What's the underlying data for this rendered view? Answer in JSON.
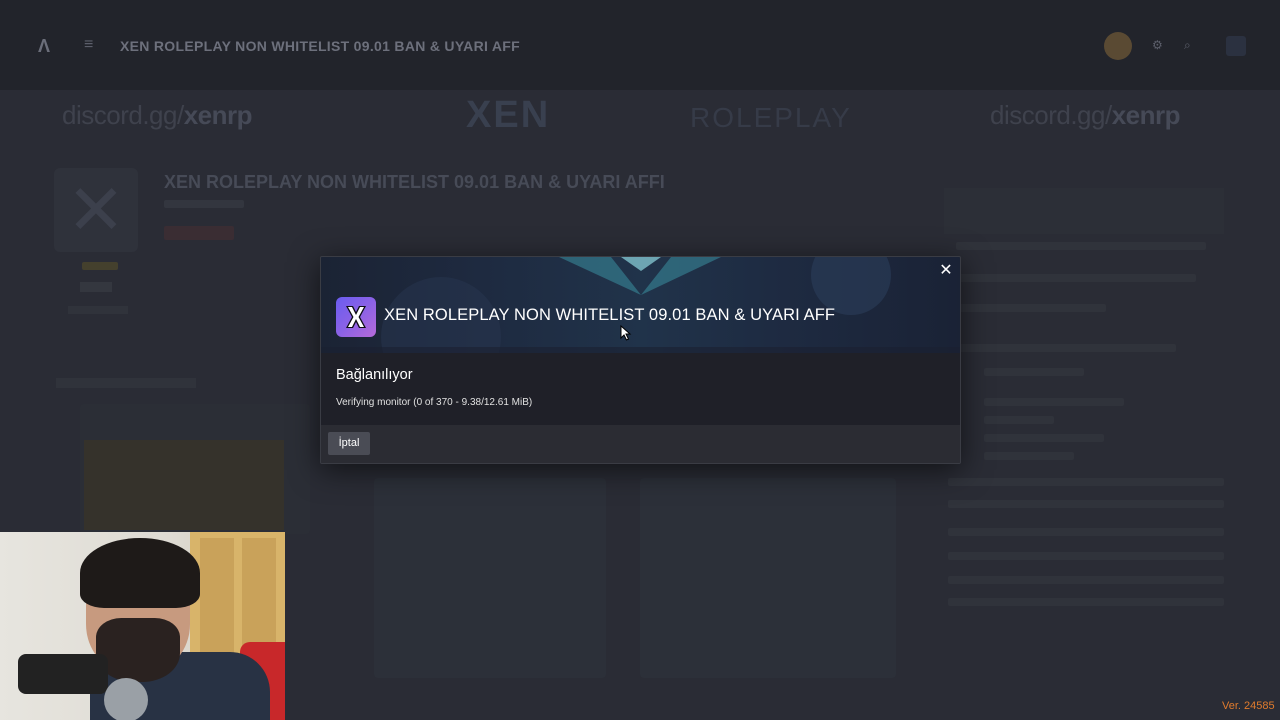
{
  "background": {
    "topbar_title": "XEN ROLEPLAY NON WHITELIST 09.01 BAN & UYARI AFF",
    "banner_left_prefix": "discord.gg/",
    "banner_left_brand": "xenrp",
    "banner_center_word1": "XEN",
    "banner_center_word2": "ROLEPLAY",
    "banner_right_prefix": "discord.gg/",
    "banner_right_brand": "xenrp",
    "server_title": "XEN ROLEPLAY NON WHITELIST 09.01 BAN & UYARI AFFI"
  },
  "modal": {
    "title": "XEN ROLEPLAY NON WHITELIST 09.01 BAN & UYARI AFF",
    "status_title": "Bağlanılıyor",
    "status_detail": "Verifying monitor (0 of 370 - 9.38/12.61 MiB)",
    "cancel_label": "İptal",
    "close_icon": "close-icon",
    "logo_icon": "x-logo-icon"
  },
  "footer": {
    "version": "Ver. 24585"
  },
  "colors": {
    "accent_version": "#e07b2d",
    "modal_body": "#1f2028",
    "logo_gradient_start": "#6a5cf0",
    "logo_gradient_end": "#b66ad9"
  }
}
